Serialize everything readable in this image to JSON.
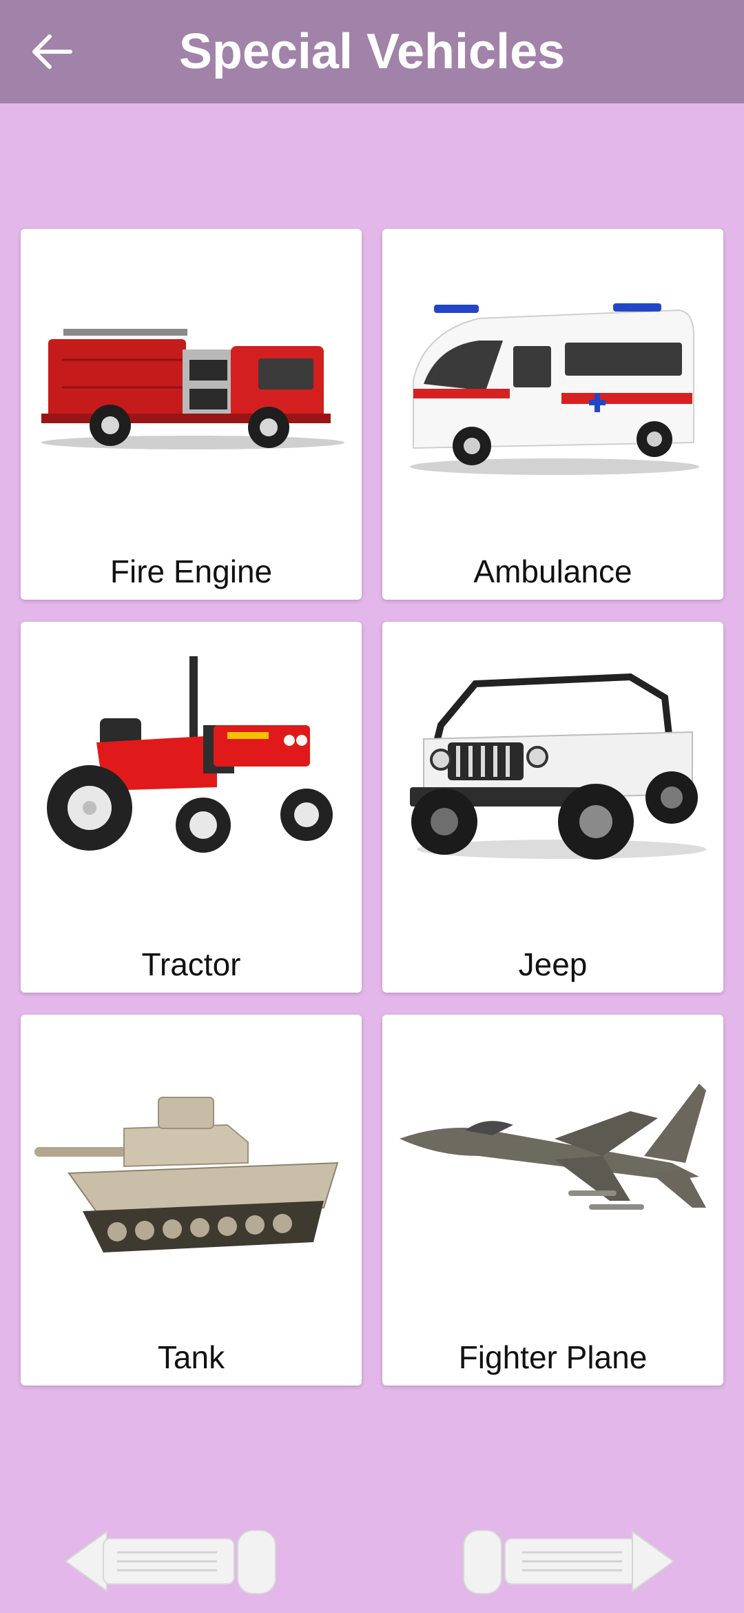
{
  "appbar": {
    "title": "Special Vehicles",
    "back_icon": "arrow-left-icon"
  },
  "colors": {
    "background": "#e3b7e9",
    "appbar": "#a182a8",
    "card": "#ffffff",
    "nav_button": "#f2f2f2"
  },
  "vehicles": [
    {
      "label": "Fire Engine",
      "icon": "fire-engine-image"
    },
    {
      "label": "Ambulance",
      "icon": "ambulance-image"
    },
    {
      "label": "Tractor",
      "icon": "tractor-image"
    },
    {
      "label": "Jeep",
      "icon": "jeep-image"
    },
    {
      "label": "Tank",
      "icon": "tank-image"
    },
    {
      "label": "Fighter Plane",
      "icon": "fighter-plane-image"
    }
  ],
  "navigation": {
    "previous_icon": "previous-arrow-icon",
    "next_icon": "next-arrow-icon"
  }
}
